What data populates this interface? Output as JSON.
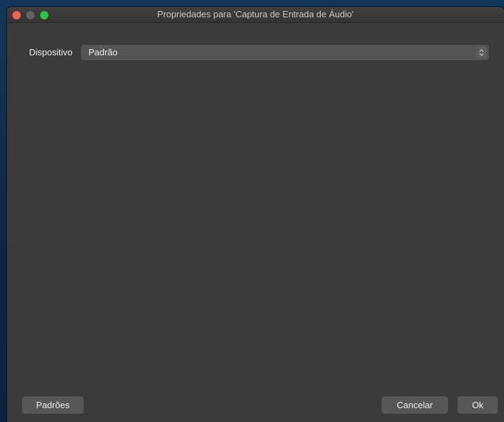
{
  "window": {
    "title": "Propriedades para 'Captura de Entrada de Áudio'"
  },
  "form": {
    "device_label": "Dispositivo",
    "device_value": "Padrão"
  },
  "footer": {
    "defaults_label": "Padrões",
    "cancel_label": "Cancelar",
    "ok_label": "Ok"
  },
  "icons": {
    "select_arrows": "chevron-up-down-icon"
  },
  "colors": {
    "close": "#ff5f57",
    "minimize": "#636363",
    "zoom": "#28c840",
    "panel": "#3b3b3b"
  }
}
